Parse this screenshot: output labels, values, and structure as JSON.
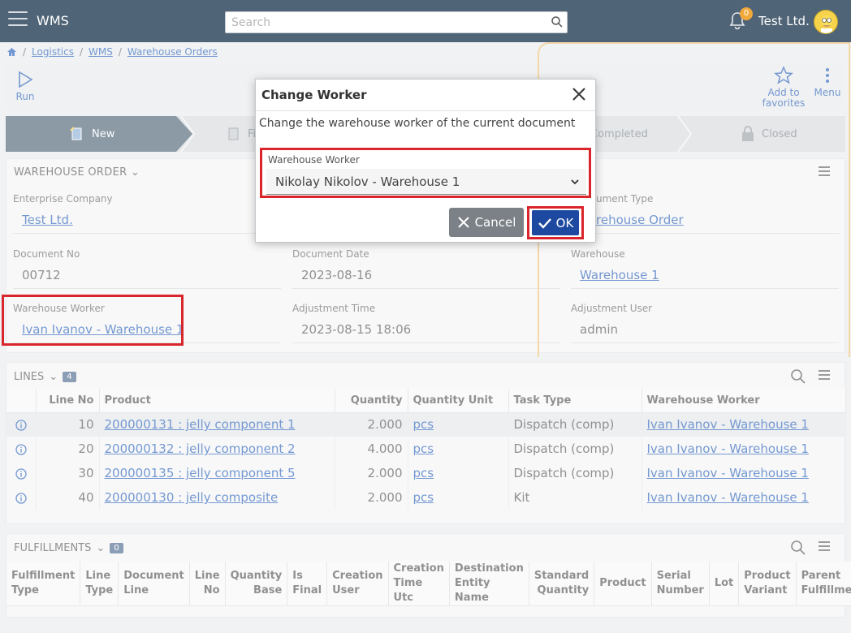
{
  "app": {
    "title": "WMS",
    "company": "Test Ltd.",
    "notification_count": "0"
  },
  "search": {
    "placeholder": "Search"
  },
  "breadcrumb": [
    "Logistics",
    "WMS",
    "Warehouse Orders"
  ],
  "toolbar": {
    "run": "Run",
    "favorites": "Add to\nfavorites",
    "menu": "Menu"
  },
  "stepper": {
    "new": "New",
    "firm": "Fi",
    "completed": "Completed",
    "closed": "Closed"
  },
  "order": {
    "section_title": "WAREHOUSE ORDER",
    "fields": {
      "enterprise_company": {
        "label": "Enterprise Company",
        "value": "Test Ltd."
      },
      "document_type": {
        "label": "ument Type",
        "value": "rehouse Order"
      },
      "document_no": {
        "label": "Document No",
        "value": "00712"
      },
      "document_date": {
        "label": "Document Date",
        "value": "2023-08-16"
      },
      "warehouse": {
        "label": "Warehouse",
        "value": "Warehouse 1"
      },
      "warehouse_worker": {
        "label": "Warehouse Worker",
        "value": "Ivan Ivanov - Warehouse 1"
      },
      "adjustment_time": {
        "label": "Adjustment Time",
        "value": "2023-08-15 18:06"
      },
      "adjustment_user": {
        "label": "Adjustment User",
        "value": "admin"
      }
    }
  },
  "lines": {
    "title": "LINES",
    "count": "4",
    "columns": [
      "Line No",
      "Product",
      "Quantity",
      "Quantity Unit",
      "Task Type",
      "Warehouse Worker"
    ],
    "rows": [
      {
        "line_no": "10",
        "product": "200000131 : jelly component 1",
        "quantity": "2.000",
        "unit": "pcs",
        "task_type": "Dispatch (comp)",
        "worker": "Ivan Ivanov - Warehouse 1"
      },
      {
        "line_no": "20",
        "product": "200000132 : jelly component 2",
        "quantity": "4.000",
        "unit": "pcs",
        "task_type": "Dispatch (comp)",
        "worker": "Ivan Ivanov - Warehouse 1"
      },
      {
        "line_no": "30",
        "product": "200000135 : jelly component 5",
        "quantity": "2.000",
        "unit": "pcs",
        "task_type": "Dispatch (comp)",
        "worker": "Ivan Ivanov - Warehouse 1"
      },
      {
        "line_no": "40",
        "product": "200000130 : jelly composite",
        "quantity": "2.000",
        "unit": "pcs",
        "task_type": "Kit",
        "worker": "Ivan Ivanov - Warehouse 1"
      }
    ]
  },
  "fulfillments": {
    "title": "FULFILLMENTS",
    "count": "0",
    "columns": [
      "Fulfillment\nType",
      "Line\nType",
      "Document\nLine",
      "Line\nNo",
      "Quantity\nBase",
      "Is\nFinal",
      "Creation\nUser",
      "Creation\nTime Utc",
      "Destination\nEntity Name",
      "Standard\nQuantity",
      "Product",
      "Serial\nNumber",
      "Lot",
      "Product\nVariant",
      "Parent\nFulfillment"
    ]
  },
  "dialog": {
    "title": "Change Worker",
    "message": "Change the warehouse worker of the current document",
    "field_label": "Warehouse Worker",
    "field_value": "Nikolay Nikolov - Warehouse 1",
    "cancel": "Cancel",
    "ok": "OK"
  },
  "colors": {
    "topbar": "#4f6476",
    "accent": "#1d4aa0",
    "highlight": "#d9262c",
    "link": "#2a62b8"
  }
}
